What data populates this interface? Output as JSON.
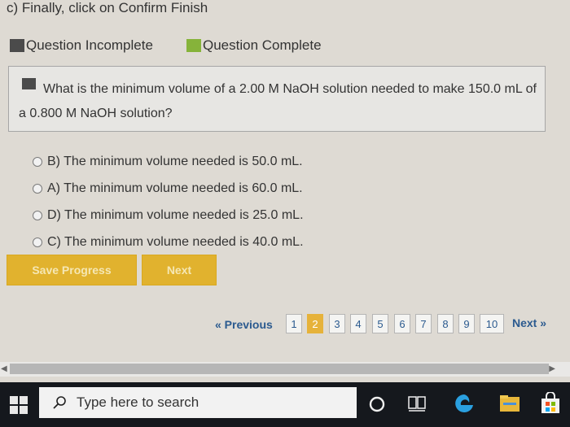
{
  "instruction": "c) Finally, click on Confirm Finish",
  "legend": {
    "incomplete_label": "Question Incomplete",
    "complete_label": "Question Complete",
    "incomplete_color": "#4b4b4b",
    "complete_color": "#86b33a"
  },
  "question": {
    "text": "What is the minimum volume of a 2.00 M NaOH solution needed to make 150.0 mL of a 0.800 M NaOH solution?"
  },
  "options": [
    "B) The minimum volume needed is 50.0 mL.",
    "A) The minimum volume needed is 60.0 mL.",
    "D) The minimum volume needed is 25.0 mL.",
    "C) The minimum volume needed is 40.0 mL."
  ],
  "buttons": {
    "save": "Save Progress",
    "next": "Next"
  },
  "pagination": {
    "previous": "« Previous",
    "next": "Next »",
    "pages": [
      "1",
      "2",
      "3",
      "4",
      "5",
      "6",
      "7",
      "8",
      "9",
      "10"
    ],
    "current": "2"
  },
  "taskbar": {
    "search_placeholder": "Type here to search",
    "icons": [
      "windows-start-icon",
      "search-icon",
      "cortana-icon",
      "task-view-icon",
      "edge-icon",
      "file-explorer-icon",
      "store-icon"
    ]
  },
  "colors": {
    "accent": "#e1b22e",
    "link": "#2b5a8f"
  }
}
